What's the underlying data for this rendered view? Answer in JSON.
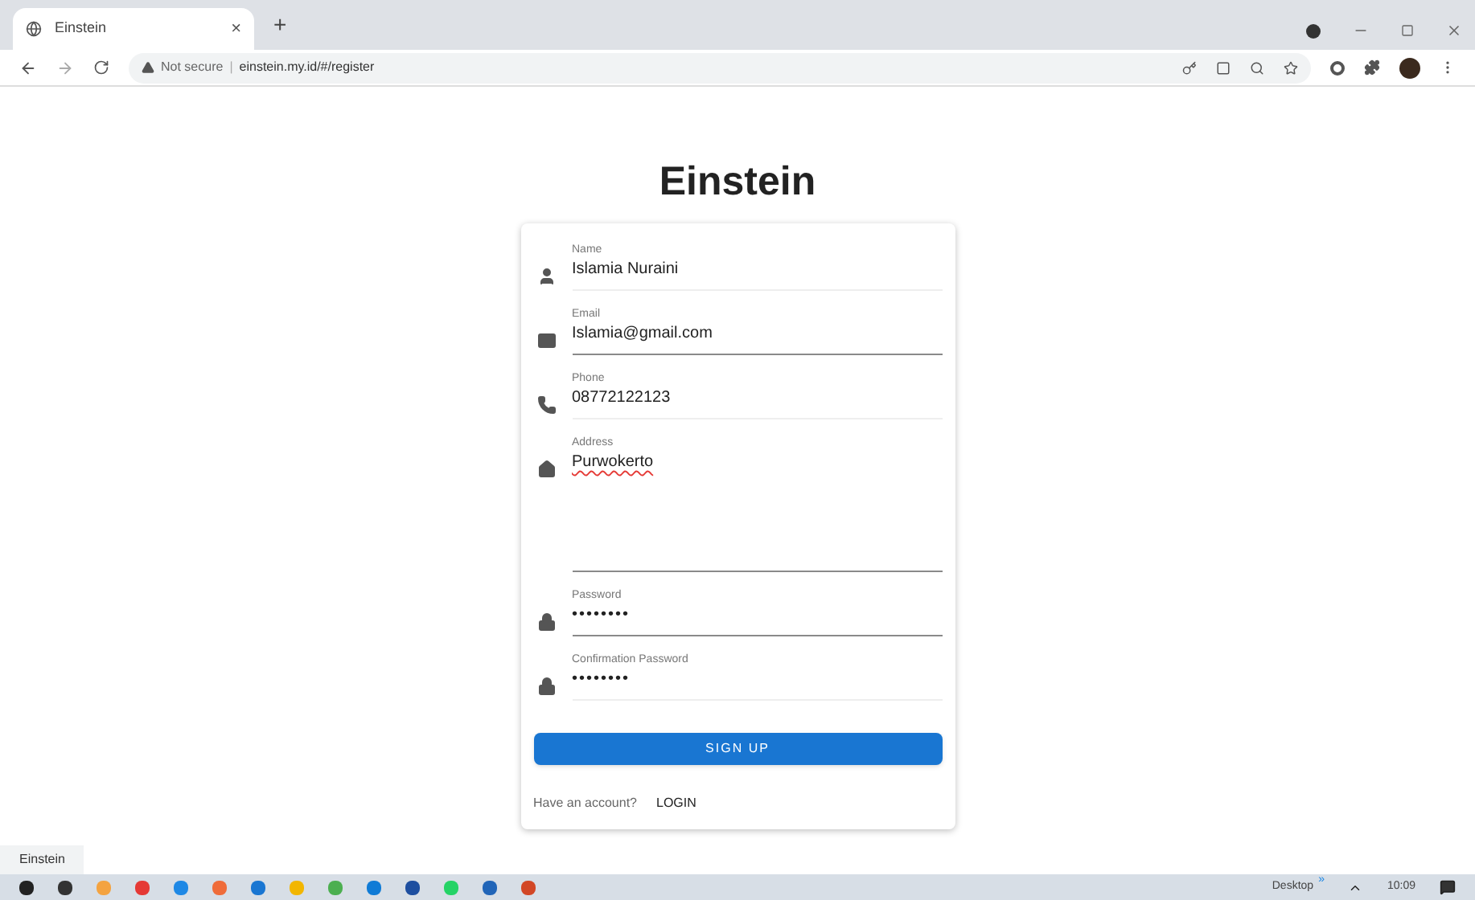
{
  "browser": {
    "tab_title": "Einstein",
    "tab_close": "×",
    "new_tab": "+",
    "security": "Not secure",
    "separator": "|",
    "url": "einstein.my.id/#/register"
  },
  "page": {
    "title": "Einstein"
  },
  "form": {
    "fields": [
      {
        "kind": "text",
        "label": "Name",
        "value": "Islamia Nuraini",
        "focused": false
      },
      {
        "kind": "text",
        "label": "Email",
        "value": "Islamia@gmail.com",
        "focused": true
      },
      {
        "kind": "text",
        "label": "Phone",
        "value": "08772122123",
        "focused": false
      },
      {
        "kind": "textarea",
        "label": "Address",
        "value": "Purwokerto",
        "focused": true
      },
      {
        "kind": "password",
        "label": "Password",
        "value": "••••••••",
        "focused": true
      },
      {
        "kind": "password",
        "label": "Confirmation Password",
        "value": "••••••••",
        "focused": false
      }
    ],
    "submit": "SIGN UP",
    "prompt": "Have an account?",
    "login": "LOGIN"
  },
  "status_bubble": "Einstein",
  "taskbar": {
    "desktop": "Desktop",
    "chevron": "»",
    "time": "10:09"
  }
}
